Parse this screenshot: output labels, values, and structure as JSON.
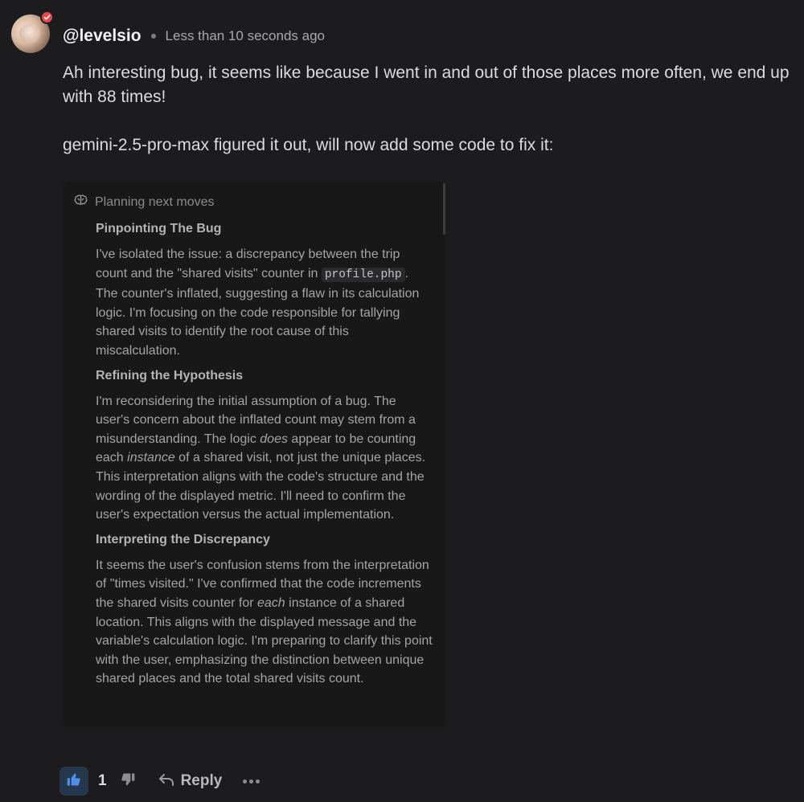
{
  "comment": {
    "username": "@levelsio",
    "timestamp": "Less than 10 seconds ago",
    "paragraphs": [
      "Ah interesting bug, it seems like because I went in and out of those places more often, we end up with 88 times!",
      "gemini-2.5-pro-max figured it out, will now add some code to fix it:"
    ]
  },
  "panel": {
    "title": "Planning next moves",
    "icon": "brain-icon",
    "sections": [
      {
        "title": "Pinpointing The Bug",
        "t1": "I've isolated the issue: a discrepancy between the trip count and the \"shared visits\" counter in ",
        "code": "profile.php",
        "t2": ". The counter's inflated, suggesting a flaw in its calculation logic. I'm focusing on the code responsible for tallying shared visits to identify the root cause of this miscalculation."
      },
      {
        "title": "Refining the Hypothesis",
        "t1": "I'm reconsidering the initial assumption of a bug. The user's concern about the inflated count may stem from a misunderstanding. The logic ",
        "em1": "does",
        "t2": " appear to be counting each ",
        "em2": "instance",
        "t3": " of a shared visit, not just the unique places. This interpretation aligns with the code's structure and the wording of the displayed metric. I'll need to confirm the user's expectation versus the actual implementation."
      },
      {
        "title": "Interpreting the Discrepancy",
        "t1": "It seems the user's confusion stems from the interpretation of \"times visited.\" I've confirmed that the code increments the shared visits counter for ",
        "em1": "each",
        "t2": " instance of a shared location. This aligns with the displayed message and the variable's calculation logic. I'm preparing to clarify this point with the user, emphasizing the distinction between unique shared places and the total shared visits count."
      }
    ]
  },
  "actions": {
    "like_count": "1",
    "reply_label": "Reply"
  },
  "colors": {
    "background": "#1c1c1e",
    "panel": "#181818",
    "verified_badge": "#e5484d",
    "like_active": "#3b82f6"
  }
}
